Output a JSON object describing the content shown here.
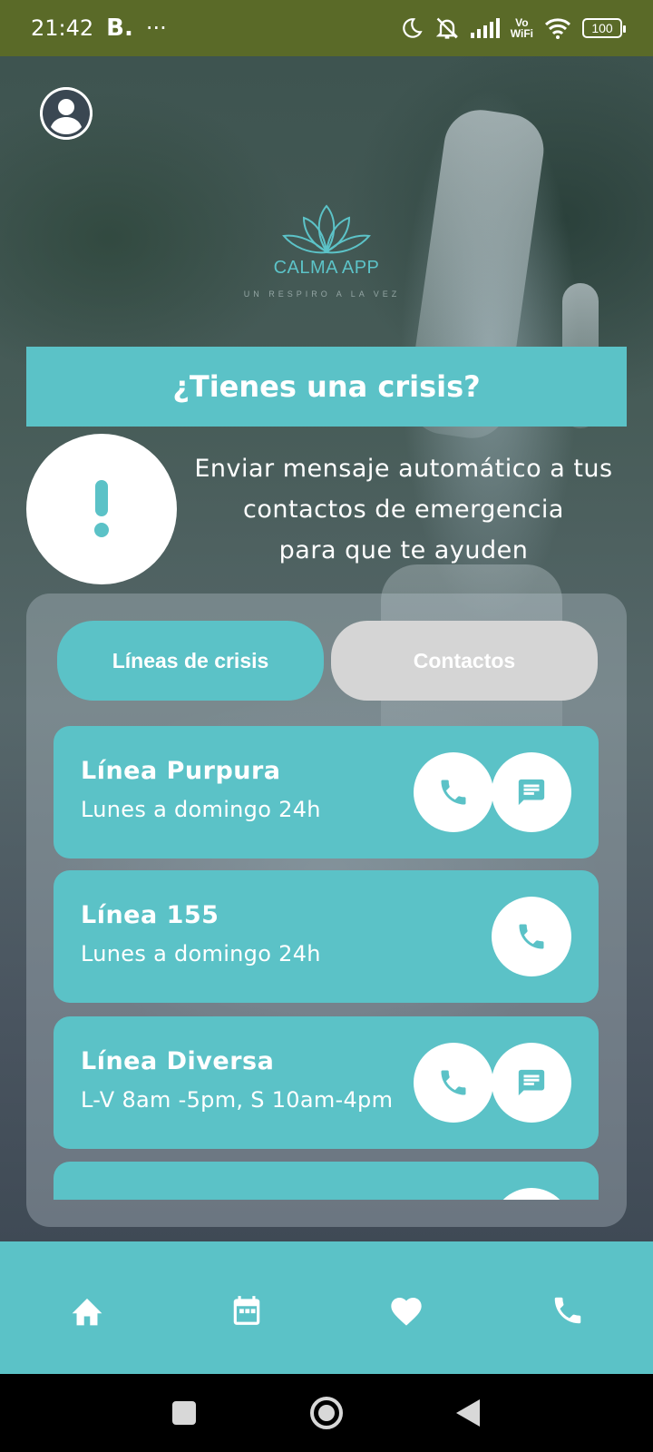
{
  "status_bar": {
    "time": "21:42",
    "carrier_badge": "B.",
    "more": "···",
    "battery": "100",
    "vowifi_top": "Vo",
    "vowifi_bottom": "WiFi"
  },
  "logo": {
    "name": "CALMA APP",
    "tagline": "UN RESPIRO A LA VEZ",
    "icon": "lotus-icon"
  },
  "crisis": {
    "header": "¿Tienes una crisis?",
    "alert_icon": "exclamation-icon",
    "description_lines": [
      "Enviar mensaje automático a tus",
      "contactos de emergencia",
      "para que te ayuden"
    ]
  },
  "tabs": [
    {
      "label": "Líneas de crisis",
      "active": true
    },
    {
      "label": "Contactos",
      "active": false
    }
  ],
  "lines": [
    {
      "name": "Línea Purpura",
      "hours": "Lunes a domingo 24h",
      "actions": [
        "phone-icon",
        "message-icon"
      ]
    },
    {
      "name": "Línea 155",
      "hours": "Lunes a domingo 24h",
      "actions": [
        "phone-icon"
      ]
    },
    {
      "name": "Línea Diversa",
      "hours": "L-V 8am -5pm, S 10am-4pm",
      "actions": [
        "phone-icon",
        "message-icon"
      ]
    },
    {
      "name": "",
      "hours": "",
      "actions": [
        "message-icon"
      ]
    }
  ],
  "bottom_nav": [
    "home-icon",
    "calendar-icon",
    "heart-icon",
    "phone-icon"
  ],
  "colors": {
    "accent": "#5bc2c7",
    "tab_inactive": "#d5d5d5",
    "status_bar": "#5a6a28"
  }
}
